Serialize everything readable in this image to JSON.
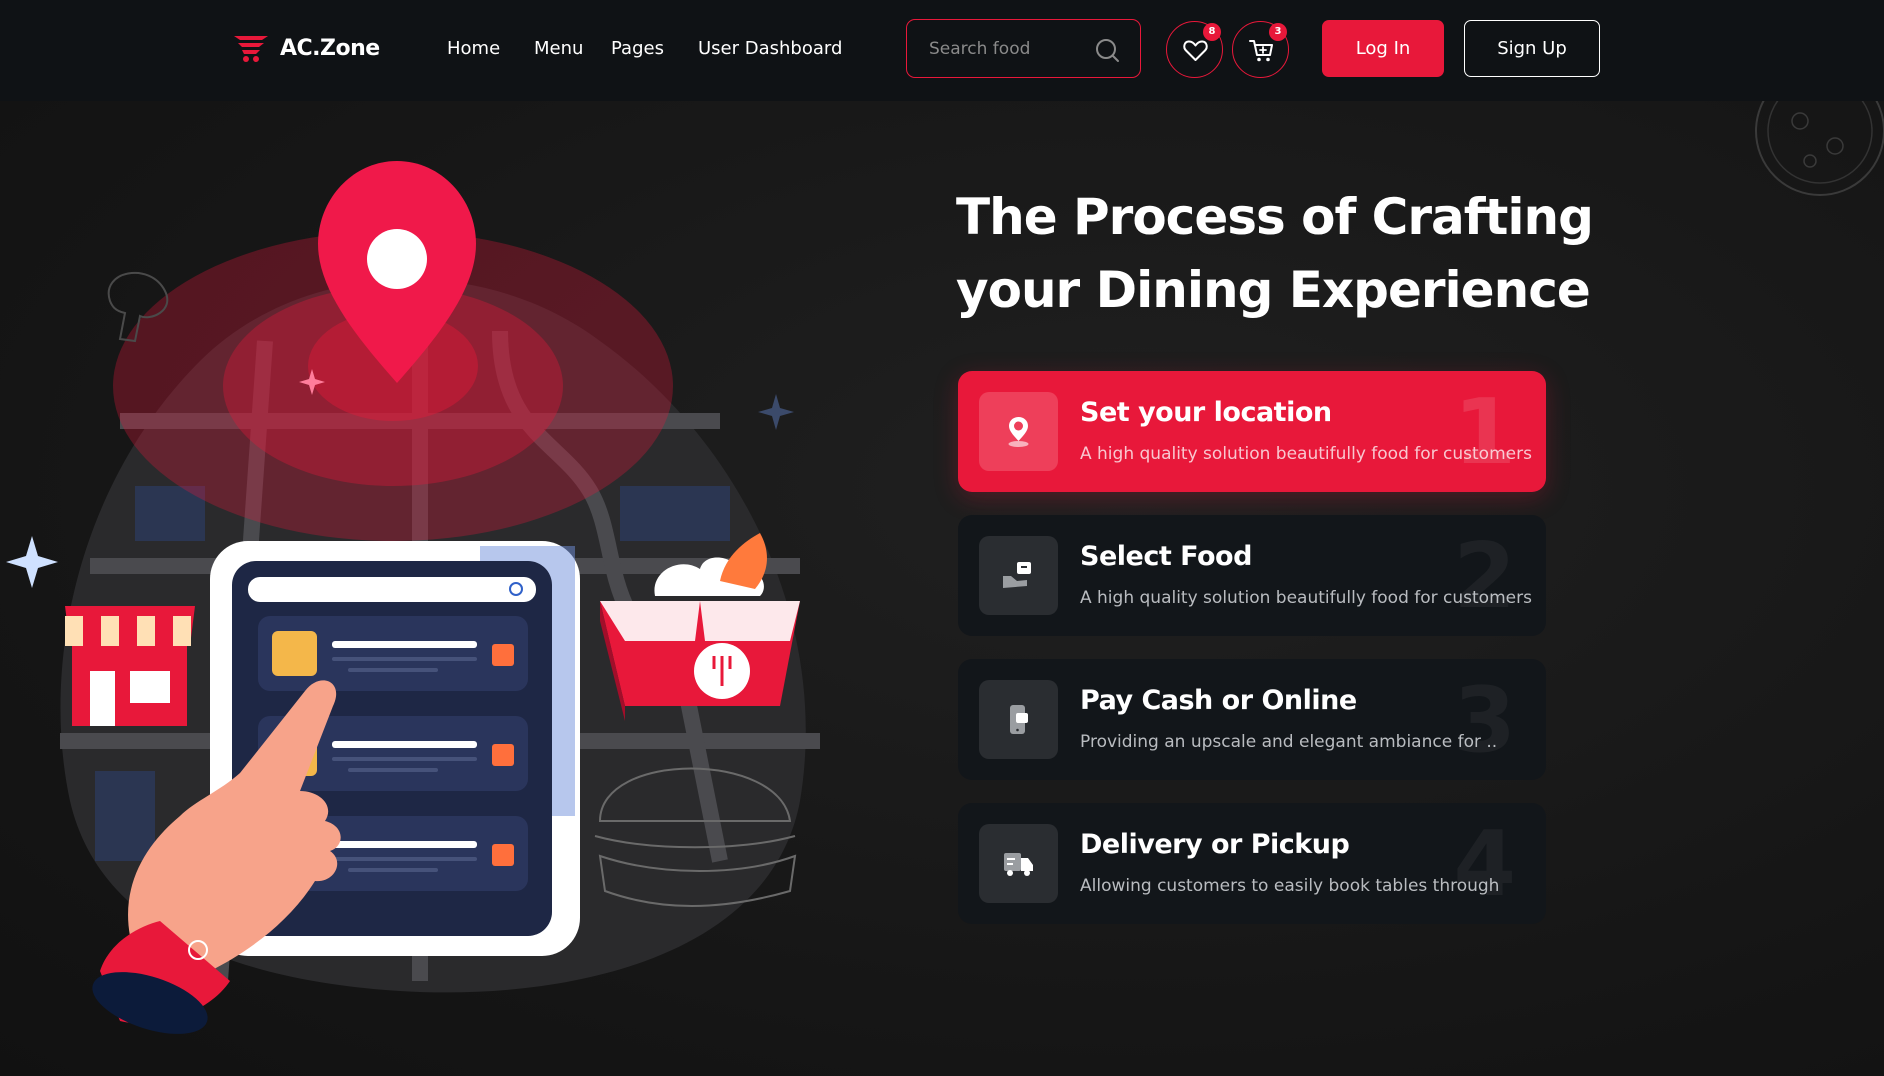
{
  "brand": {
    "name": "AC.Zone",
    "accent": "#e8183a",
    "background": "#161616",
    "navbar_bg": "#0f1215"
  },
  "nav": {
    "links": [
      "Home",
      "Menu",
      "Pages",
      "User Dashboard"
    ],
    "search": {
      "placeholder": "Search food",
      "value": ""
    },
    "wishlist": {
      "icon": "heart-icon",
      "count": "8"
    },
    "cart": {
      "icon": "cart-icon",
      "count": "3"
    },
    "login_label": "Log In",
    "signup_label": "Sign Up"
  },
  "hero": {
    "title": "The Process of Crafting your Dining Experience",
    "steps": [
      {
        "number": "1",
        "title": "Set your location",
        "description": "A high quality solution beautifully food for customers",
        "icon": "location-pin-icon",
        "active": true
      },
      {
        "number": "2",
        "title": "Select Food",
        "description": "A high quality solution beautifully food for customers",
        "icon": "hand-box-icon",
        "active": false
      },
      {
        "number": "3",
        "title": "Pay Cash or Online",
        "description": "Providing an upscale and elegant ambiance for ..",
        "icon": "phone-pay-icon",
        "active": false
      },
      {
        "number": "4",
        "title": "Delivery or Pickup",
        "description": "Allowing customers to easily book tables through",
        "icon": "delivery-truck-icon",
        "active": false
      }
    ]
  }
}
